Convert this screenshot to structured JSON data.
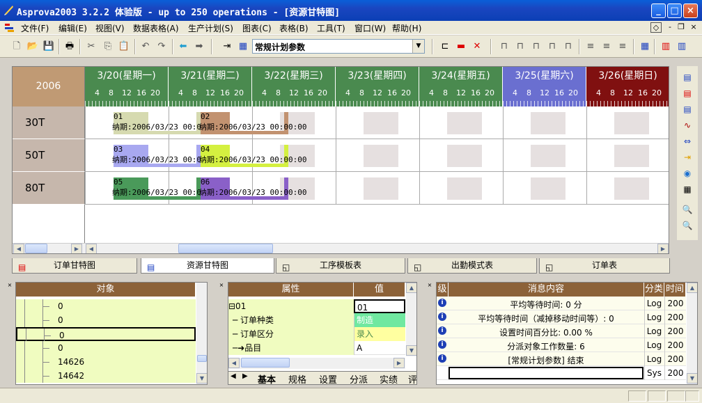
{
  "window": {
    "title": "Asprova2003 3.2.2 体验版  - up to 250 operations - [资源甘特图]",
    "btn_min": "_",
    "btn_max": "□",
    "btn_close": "×"
  },
  "menu": [
    "文件(F)",
    "编辑(E)",
    "视图(V)",
    "数据表格(A)",
    "生产计划(S)",
    "图表(C)",
    "表格(B)",
    "工具(T)",
    "窗口(W)",
    "帮助(H)"
  ],
  "mdi": {
    "a": "◇",
    "min": "-",
    "restore": "❐",
    "close": "×"
  },
  "toolbar": {
    "combo_value": "常规计划参数",
    "combo_arrow": "▼"
  },
  "gantt": {
    "year": "2006",
    "days": [
      {
        "label": "3/20(星期一)",
        "color": "#4a8a4f"
      },
      {
        "label": "3/21(星期二)",
        "color": "#4a8a4f"
      },
      {
        "label": "3/22(星期三)",
        "color": "#4a8a4f"
      },
      {
        "label": "3/23(星期四)",
        "color": "#4a8a4f"
      },
      {
        "label": "3/24(星期五)",
        "color": "#4a8a4f"
      },
      {
        "label": "3/25(星期六)",
        "color": "#6a6fd0"
      },
      {
        "label": "3/26(星期日)",
        "color": "#801010"
      }
    ],
    "hours": [
      "4",
      "8",
      "12",
      "16",
      "20"
    ],
    "resources": [
      "30T",
      "50T",
      "80T"
    ],
    "bars": [
      {
        "row": 0,
        "id": "01",
        "due": "纳期:2006/03/23 00:00",
        "color": "#d6dab0"
      },
      {
        "row": 0,
        "id": "02",
        "due": "纳期:2006/03/23 00:00:00",
        "color": "#c29270"
      },
      {
        "row": 1,
        "id": "03",
        "due": "纳期:2006/03/23 00:00",
        "color": "#a8a8f0"
      },
      {
        "row": 1,
        "id": "04",
        "due": "纳期:2006/03/23 00:00:00",
        "color": "#d4f040"
      },
      {
        "row": 2,
        "id": "05",
        "due": "纳期:2006/03/23 00:00",
        "color": "#4a9a5a"
      },
      {
        "row": 2,
        "id": "06",
        "due": "纳期:2006/03/23 00:00:00",
        "color": "#8a60c8"
      }
    ]
  },
  "tabs": [
    "订单甘特图",
    "资源甘特图",
    "工序模板表",
    "出勤模式表",
    "订单表"
  ],
  "object_panel": {
    "header": "对象",
    "items": [
      "0",
      "0",
      "0",
      "0",
      "14626",
      "14642"
    ]
  },
  "property_panel": {
    "col_attr": "属性",
    "col_value": "值",
    "rows": [
      {
        "name": "⊟01",
        "value": "01"
      },
      {
        "name": "─ 订单种类",
        "value": "制造"
      },
      {
        "name": "─ 订单区分",
        "value": "录入"
      },
      {
        "name": "─➜品目",
        "value": "A"
      }
    ],
    "tabs": [
      "基本",
      "规格",
      "设置",
      "分派",
      "实绩",
      "评"
    ]
  },
  "message_panel": {
    "col_level": "级",
    "col_content": "消息内容",
    "col_class": "分类",
    "col_time": "时间",
    "rows": [
      {
        "text": "平均等待时间: 0 分",
        "cls": "Log",
        "time": "200"
      },
      {
        "text": "平均等待时间（减掉移动时间等）: 0",
        "cls": "Log",
        "time": "200"
      },
      {
        "text": "设置时间百分比:  0.00 %",
        "cls": "Log",
        "time": "200"
      },
      {
        "text": "分派对象工作数量:  6",
        "cls": "Log",
        "time": "200"
      },
      {
        "text": "[常规计划参数] 结束",
        "cls": "Log",
        "time": "200"
      },
      {
        "text": "",
        "cls": "Sys",
        "time": "200"
      }
    ]
  }
}
